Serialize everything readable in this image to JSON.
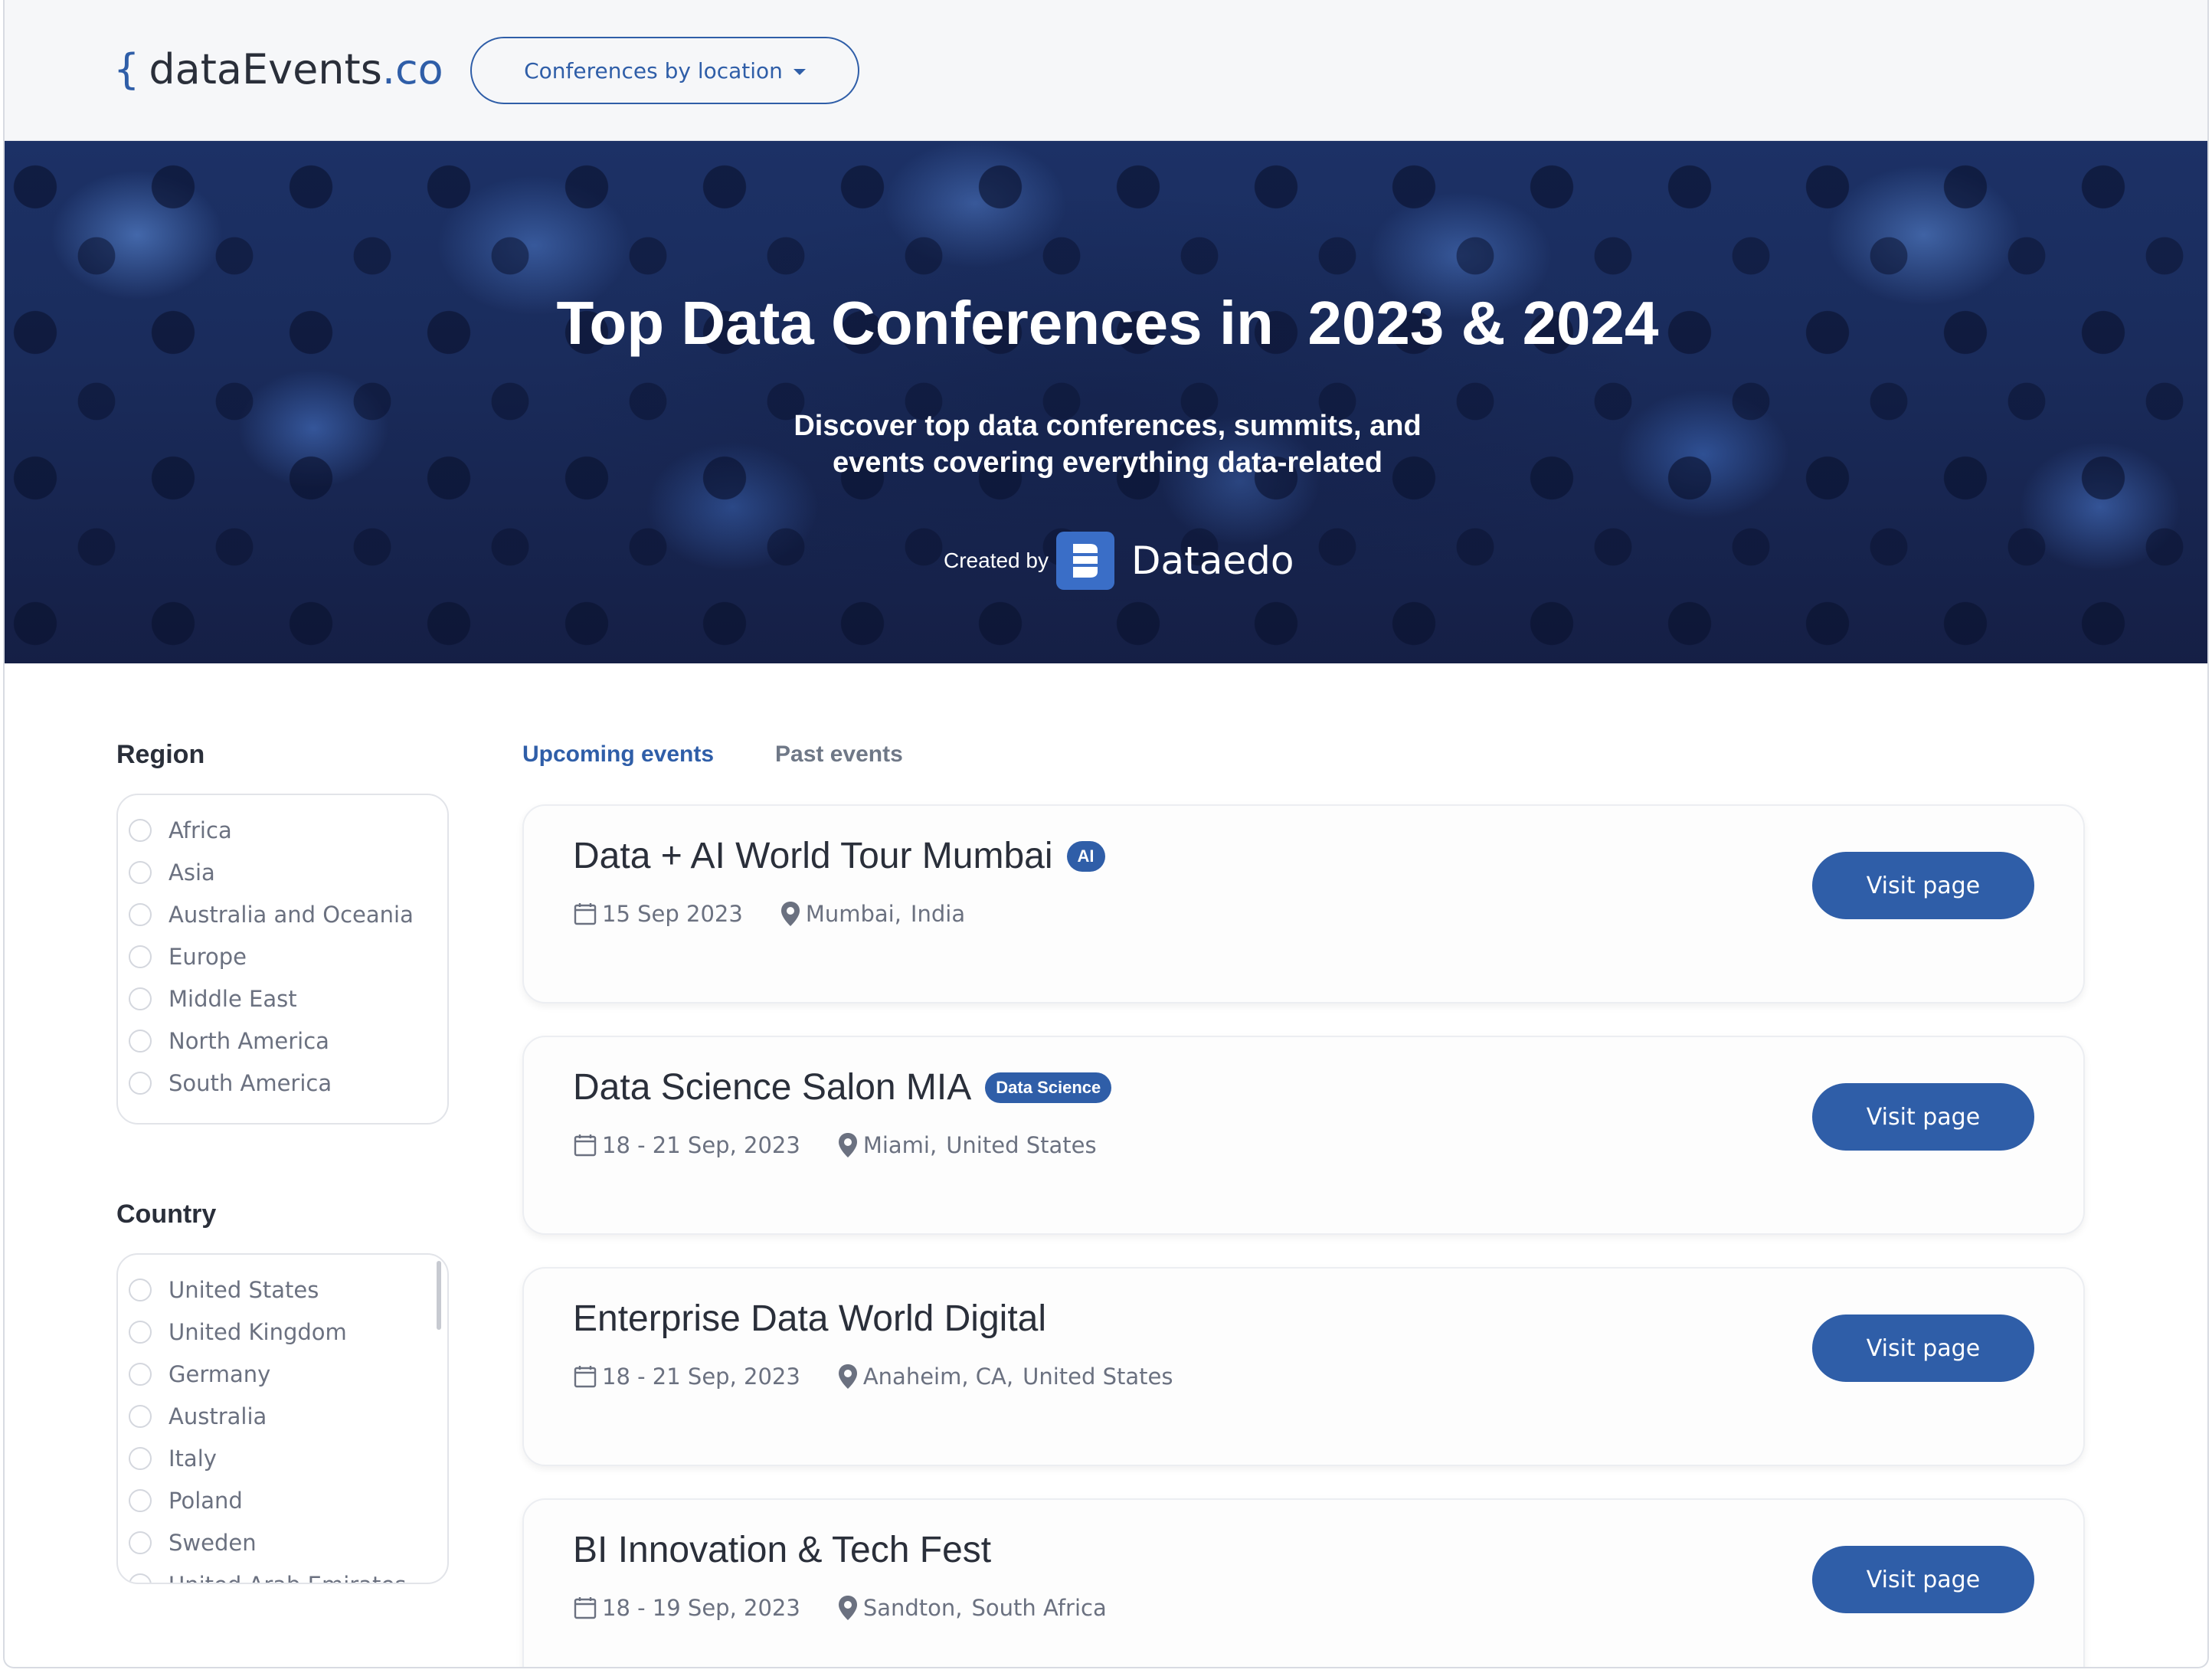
{
  "header": {
    "logo_brace": "{",
    "logo_name": "dataEvents",
    "logo_tld": ".co",
    "location_button": "Conferences by location"
  },
  "hero": {
    "title": "Top Data Conferences in  2023 & 2024",
    "subtitle_line1": "Discover top data conferences, summits, and",
    "subtitle_line2": "events covering everything data-related",
    "created_by": "Created by",
    "brand": "Dataedo"
  },
  "filters": {
    "region": {
      "title": "Region",
      "items": [
        "Africa",
        "Asia",
        "Australia and Oceania",
        "Europe",
        "Middle East",
        "North America",
        "South America"
      ]
    },
    "country": {
      "title": "Country",
      "items": [
        "United States",
        "United Kingdom",
        "Germany",
        "Australia",
        "Italy",
        "Poland",
        "Sweden",
        "United Arab Emirates"
      ]
    }
  },
  "tabs": {
    "upcoming": "Upcoming events",
    "past": "Past events"
  },
  "events": [
    {
      "title": "Data + AI World Tour Mumbai",
      "badge": "AI",
      "date": "15 Sep 2023",
      "city": "Mumbai,",
      "country": "India",
      "button": "Visit page"
    },
    {
      "title": "Data Science Salon MIA",
      "badge": "Data Science",
      "date": "18 - 21 Sep, 2023",
      "city": "Miami,",
      "country": "United States",
      "button": "Visit page"
    },
    {
      "title": "Enterprise Data World Digital",
      "badge": "",
      "date": "18 - 21 Sep, 2023",
      "city": "Anaheim, CA,",
      "country": "United States",
      "button": "Visit page"
    },
    {
      "title": "BI Innovation & Tech Fest",
      "badge": "",
      "date": "18 - 19 Sep, 2023",
      "city": "Sandton,",
      "country": "South Africa",
      "button": "Visit page"
    }
  ],
  "colors": {
    "accent": "#2f5ea8",
    "text": "#2a2f3a",
    "muted": "#6b7180"
  },
  "icons": {
    "date": "calendar-icon",
    "location": "map-pin-icon",
    "dropdown": "chevron-down-icon"
  }
}
